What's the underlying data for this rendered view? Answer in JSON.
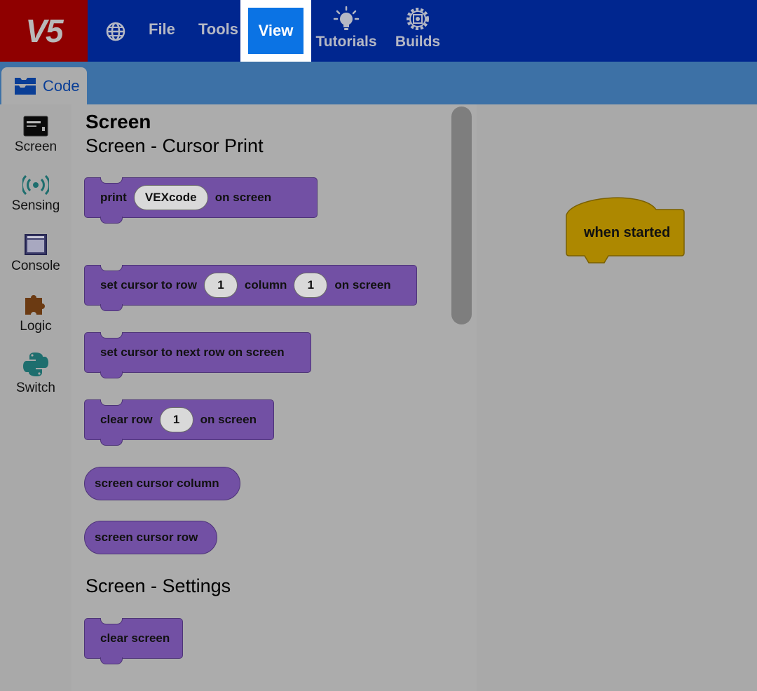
{
  "colors": {
    "menubar": "#00268f",
    "logo_bg": "#8f0000",
    "view_active": "#0b73e4",
    "tabbar": "#3d71a6",
    "block_purple": "#7250a4",
    "event_gold": "#ad8800"
  },
  "menu": {
    "logo": "V5",
    "globe_icon": "globe-icon",
    "file": "File",
    "tools": "Tools",
    "view": "View",
    "tutorials": "Tutorials",
    "builds": "Builds"
  },
  "tabs": {
    "code": "Code"
  },
  "categories": [
    {
      "label": "Screen",
      "icon": "screen-icon"
    },
    {
      "label": "Sensing",
      "icon": "sensing-icon"
    },
    {
      "label": "Console",
      "icon": "console-icon"
    },
    {
      "label": "Logic",
      "icon": "puzzle-icon"
    },
    {
      "label": "Switch",
      "icon": "python-icon"
    }
  ],
  "flyout": {
    "title": "Screen",
    "section_cursor": "Screen - Cursor Print",
    "section_settings": "Screen - Settings",
    "blocks": {
      "print": {
        "pre": "print",
        "value": "VEXcode",
        "post": "on screen"
      },
      "set_cursor": {
        "pre": "set cursor to row",
        "row": "1",
        "mid": "column",
        "col": "1",
        "post": "on screen"
      },
      "next_row": {
        "text": "set cursor to next row on screen"
      },
      "clear_row": {
        "pre": "clear row",
        "value": "1",
        "post": "on screen"
      },
      "cursor_column": {
        "text": "screen cursor column"
      },
      "cursor_row": {
        "text": "screen cursor row"
      },
      "clear_screen": {
        "text": "clear screen"
      }
    }
  },
  "workspace": {
    "hat_block": "when started"
  }
}
